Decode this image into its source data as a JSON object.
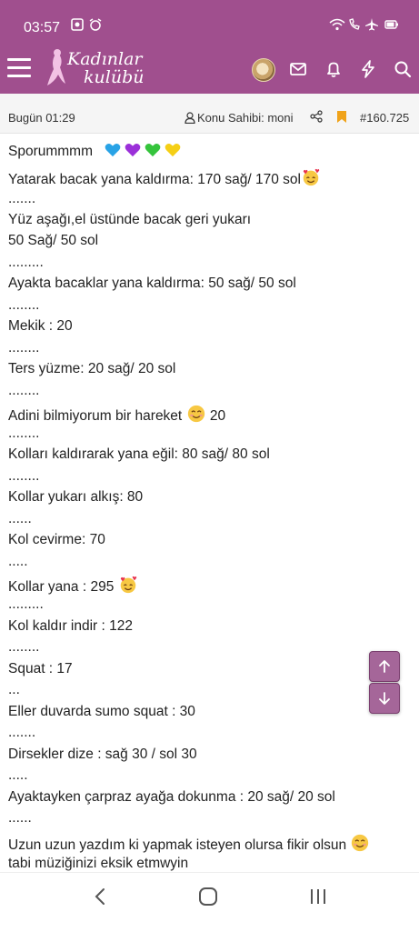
{
  "status_bar": {
    "time": "03:57"
  },
  "app": {
    "logo_line1": "Kadınlar",
    "logo_line2": "kulübü"
  },
  "thread_bar": {
    "date": "Bugün 01:29",
    "owner": "Konu Sahibi: moni",
    "post_number": "#160.725"
  },
  "post": {
    "lines": [
      "Sporummmm",
      "Yatarak bacak yana kaldırma: 170 sağ/ 170 sol",
      ".......",
      "Yüz aşağı,el üstünde bacak geri yukarı",
      "50 Sağ/ 50 sol",
      ".........",
      "Ayakta bacaklar yana kaldırma: 50 sağ/ 50 sol",
      "........",
      "Mekik : 20",
      "........",
      "Ters yüzme: 20 sağ/ 20 sol",
      "........",
      "Adini bilmiyorum bir hareket",
      "20",
      "........",
      "Kolları kaldırarak yana eğil: 80 sağ/ 80 sol",
      "........",
      "Kollar yukarı alkış: 80",
      "......",
      "Kol cevirme: 70",
      ".....",
      "Kollar yana : 295",
      ".........",
      "Kol kaldır indir : 122",
      "........",
      "Squat : 17",
      "...",
      "Eller duvarda sumo squat : 30",
      ".......",
      "Dirsekler dize : sağ 30 / sol 30",
      ".....",
      "Ayaktayken çarpraz ayağa dokunma : 20 sağ/ 20 sol",
      "......",
      "Uzun uzun yazdım ki yapmak isteyen olursa fikir olsun",
      "tabi müziğinizi eksik etmwyin"
    ],
    "hearts": [
      "blue-heart",
      "purple-heart",
      "green-heart",
      "yellow-heart"
    ]
  },
  "icons": {
    "menu": "hamburger-icon",
    "mail": "envelope-icon",
    "alerts": "bell-icon",
    "whats_new": "bolt-icon",
    "search": "search-icon",
    "scroll_up": "arrow-up-icon",
    "scroll_down": "arrow-down-icon"
  },
  "colors": {
    "brand": "#a04f8e",
    "bookmark": "#f0a31a",
    "scroll_button": "#a56699"
  }
}
